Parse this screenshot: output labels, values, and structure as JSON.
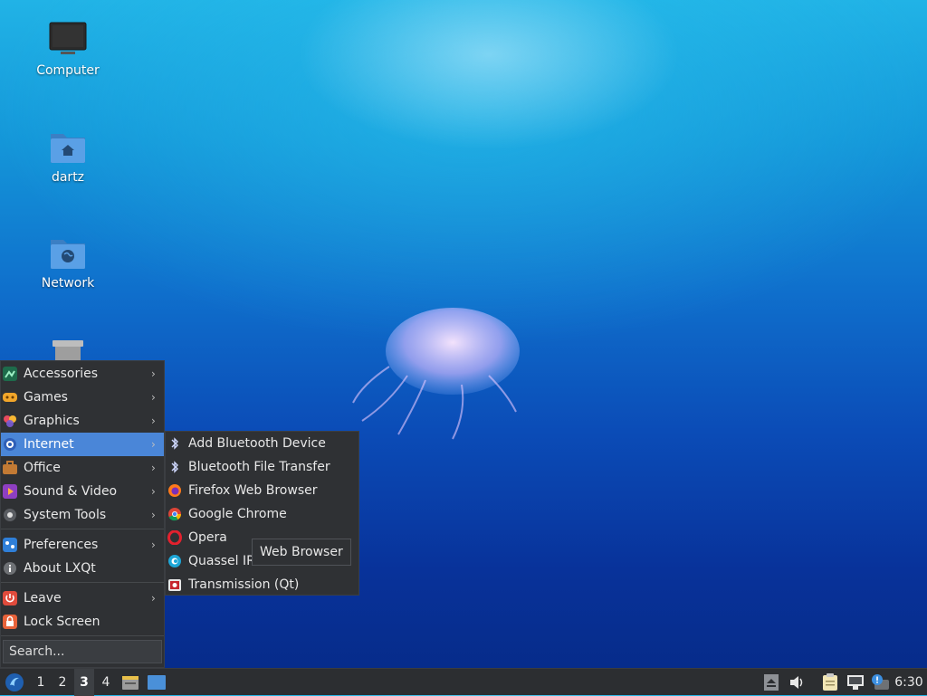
{
  "desktop": {
    "icons": [
      {
        "label": "Computer",
        "icon": "monitor-icon"
      },
      {
        "label": "dartz",
        "icon": "home-folder-icon"
      },
      {
        "label": "Network",
        "icon": "network-folder-icon"
      },
      {
        "label": "",
        "icon": "trash-icon"
      }
    ]
  },
  "menu": {
    "categories": [
      {
        "label": "Accessories",
        "icon": "accessories-icon",
        "has_submenu": true
      },
      {
        "label": "Games",
        "icon": "games-icon",
        "has_submenu": true
      },
      {
        "label": "Graphics",
        "icon": "graphics-icon",
        "has_submenu": true
      },
      {
        "label": "Internet",
        "icon": "internet-icon",
        "has_submenu": true,
        "active": true
      },
      {
        "label": "Office",
        "icon": "office-icon",
        "has_submenu": true
      },
      {
        "label": "Sound & Video",
        "icon": "sound-video-icon",
        "has_submenu": true
      },
      {
        "label": "System Tools",
        "icon": "system-tools-icon",
        "has_submenu": true
      }
    ],
    "settings": [
      {
        "label": "Preferences",
        "icon": "preferences-icon",
        "has_submenu": true
      },
      {
        "label": "About LXQt",
        "icon": "info-icon",
        "has_submenu": false
      }
    ],
    "session": [
      {
        "label": "Leave",
        "icon": "power-icon",
        "has_submenu": true
      },
      {
        "label": "Lock Screen",
        "icon": "lock-icon",
        "has_submenu": false
      }
    ],
    "search_placeholder": "Search..."
  },
  "internet_submenu": {
    "items": [
      {
        "label": "Add Bluetooth Device",
        "icon": "bluetooth-icon"
      },
      {
        "label": "Bluetooth File Transfer",
        "icon": "bluetooth-icon"
      },
      {
        "label": "Firefox Web Browser",
        "icon": "firefox-icon"
      },
      {
        "label": "Google Chrome",
        "icon": "chrome-icon"
      },
      {
        "label": "Opera",
        "icon": "opera-icon"
      },
      {
        "label": "Quassel IRC",
        "icon": "quassel-icon"
      },
      {
        "label": "Transmission (Qt)",
        "icon": "transmission-icon"
      }
    ]
  },
  "tooltip": {
    "text": "Web Browser"
  },
  "taskbar": {
    "workspaces": [
      "1",
      "2",
      "3",
      "4"
    ],
    "current_workspace": "3",
    "clock": "6:30"
  },
  "colors": {
    "menu_bg": "#2f3134",
    "highlight": "#4a86d8",
    "taskbar_bg": "#2c2e31"
  }
}
